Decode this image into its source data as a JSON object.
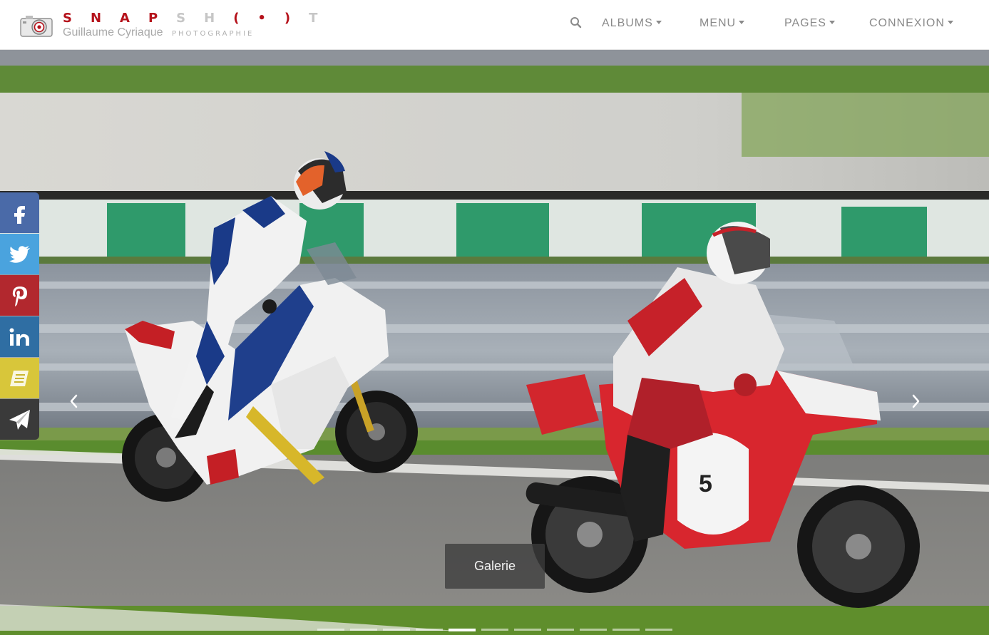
{
  "brand": {
    "top_left": "SNAP",
    "top_right": "SH",
    "top_end": "T",
    "name_part1": "Guillaume",
    "name_part2": "Cyriaque",
    "subtitle": "PHOTOGRAPHIE"
  },
  "nav": {
    "search_icon": "search-icon",
    "items": [
      {
        "label": "ALBUMS"
      },
      {
        "label": "MENU"
      },
      {
        "label": "PAGES"
      },
      {
        "label": "CONNEXION"
      }
    ]
  },
  "hero": {
    "button_label": "Galerie",
    "slide_count": 11,
    "active_slide": 5,
    "prev_icon": "chevron-left-icon",
    "next_icon": "chevron-right-icon"
  },
  "share": [
    {
      "icon": "facebook-icon",
      "color": "#4a6aa8"
    },
    {
      "icon": "twitter-icon",
      "color": "#4aa3de"
    },
    {
      "icon": "pinterest-icon",
      "color": "#b2282e"
    },
    {
      "icon": "linkedin-icon",
      "color": "#2f6ea3"
    },
    {
      "icon": "book-icon",
      "color": "#d8c63a"
    },
    {
      "icon": "send-icon",
      "color": "#3a3a3a"
    }
  ]
}
